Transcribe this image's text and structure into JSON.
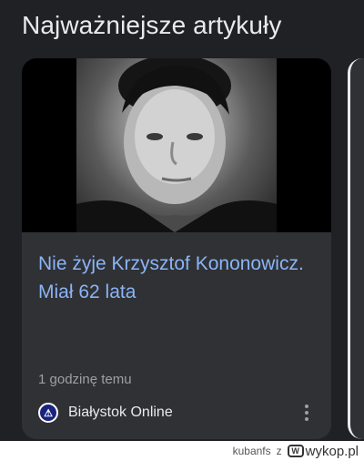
{
  "section": {
    "title": "Najważniejsze artykuły"
  },
  "card": {
    "headline": "Nie żyje Krzysztof Kononowicz. Miał 62 lata",
    "time": "1 godzinę temu",
    "source": {
      "name": "Białystok Online",
      "logo_icon": "bialystok-online-logo"
    },
    "more_icon": "more-vert-icon"
  },
  "watermark": {
    "user": "kubanfs",
    "connector": "z",
    "site": "wykop.pl",
    "logo_mark": "W"
  },
  "colors": {
    "background": "#202124",
    "card": "#303134",
    "headline": "#8ab4f8",
    "title": "#e8eaed",
    "muted": "#9aa0a6"
  }
}
